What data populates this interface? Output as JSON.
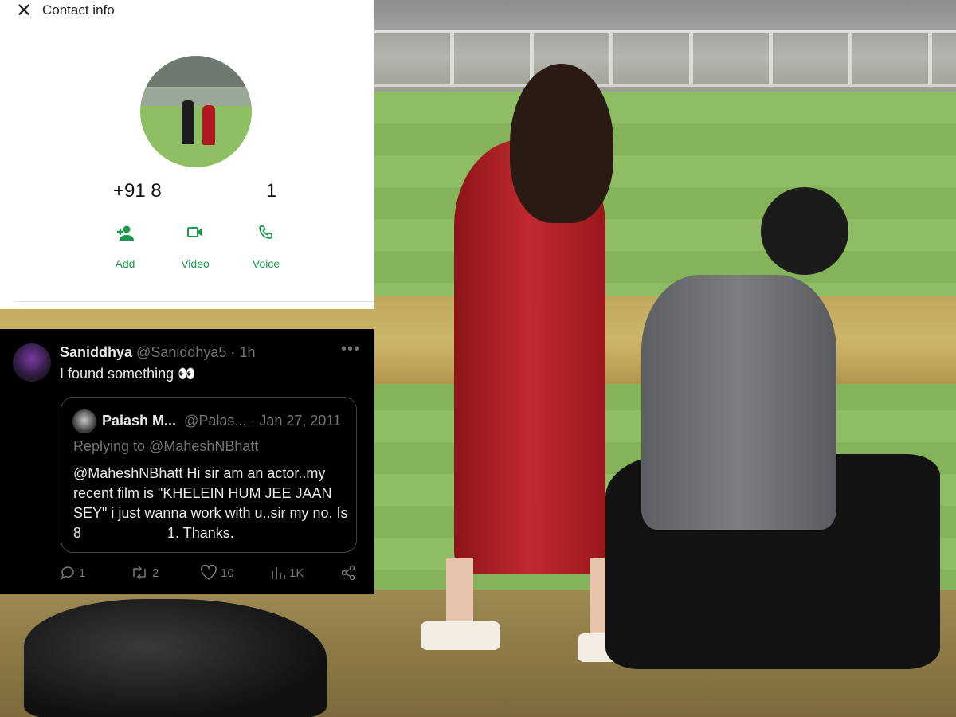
{
  "contact_panel": {
    "title": "Contact info",
    "close_icon": "close-icon",
    "phone_prefix": "+91 8",
    "phone_suffix": "1",
    "actions": [
      {
        "label": "Add",
        "icon": "add-person-icon"
      },
      {
        "label": "Video",
        "icon": "video-camera-icon"
      },
      {
        "label": "Voice",
        "icon": "phone-icon"
      }
    ],
    "accent_color": "#1d9a4b"
  },
  "tweet": {
    "name": "Saniddhya",
    "handle": "@Saniddhya5",
    "separator": "·",
    "time": "1h",
    "text": "I found something 👀",
    "quoted": {
      "name": "Palash M...",
      "handle": "@Palas...",
      "date": "· Jan 27, 2011",
      "replying_to": "Replying to @MaheshNBhatt",
      "body_start": "@MaheshNBhatt Hi sir am an actor..my recent film is \"KHELEIN HUM JEE JAAN SEY\" i just wanna work with u..sir my no. Is 8",
      "body_end": "1. Thanks."
    },
    "stats": {
      "replies": "1",
      "reposts": "2",
      "likes": "10",
      "views": "1K"
    }
  }
}
